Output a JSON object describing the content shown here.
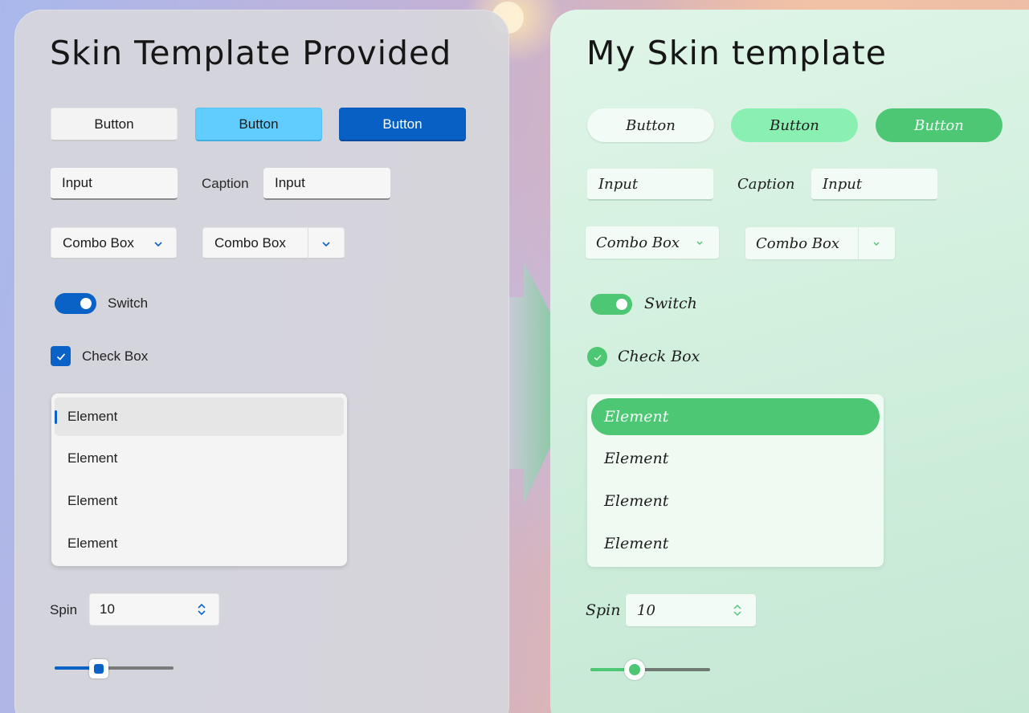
{
  "left": {
    "title": "Skin Template Provided",
    "buttons": [
      "Button",
      "Button",
      "Button"
    ],
    "input": {
      "value": "Input"
    },
    "captioned_input": {
      "caption": "Caption",
      "value": "Input"
    },
    "combo_boxes": [
      "Combo Box",
      "Combo Box"
    ],
    "switch": {
      "label": "Switch",
      "on": true
    },
    "checkbox": {
      "label": "Check Box",
      "checked": true
    },
    "list": [
      "Element",
      "Element",
      "Element",
      "Element"
    ],
    "selected_index": 0,
    "spin": {
      "label": "Spin",
      "value": "10"
    },
    "slider": {
      "value": 0.38
    },
    "colors": {
      "accent": "#0a62c6",
      "light_button": "#61cdff",
      "panel": "#d6d6dc"
    }
  },
  "right": {
    "title": "My Skin template",
    "buttons": [
      "Button",
      "Button",
      "Button"
    ],
    "input": {
      "value": "Input"
    },
    "captioned_input": {
      "caption": "Caption",
      "value": "Input"
    },
    "combo_boxes": [
      "Combo Box",
      "Combo Box"
    ],
    "switch": {
      "label": "Switch",
      "on": true
    },
    "checkbox": {
      "label": "Check Box",
      "checked": true
    },
    "list": [
      "Element",
      "Element",
      "Element",
      "Element"
    ],
    "selected_index": 0,
    "spin": {
      "label": "Spin",
      "value": "10"
    },
    "slider": {
      "value": 0.37
    },
    "colors": {
      "accent": "#4dc773",
      "light_button": "#8af0b1",
      "panel": "#d4f0df"
    }
  },
  "icons": {
    "chevron": "chevron-down-icon",
    "check": "checkmark-icon",
    "spin": "up-down-arrows-icon",
    "arrow": "right-arrow-icon"
  }
}
